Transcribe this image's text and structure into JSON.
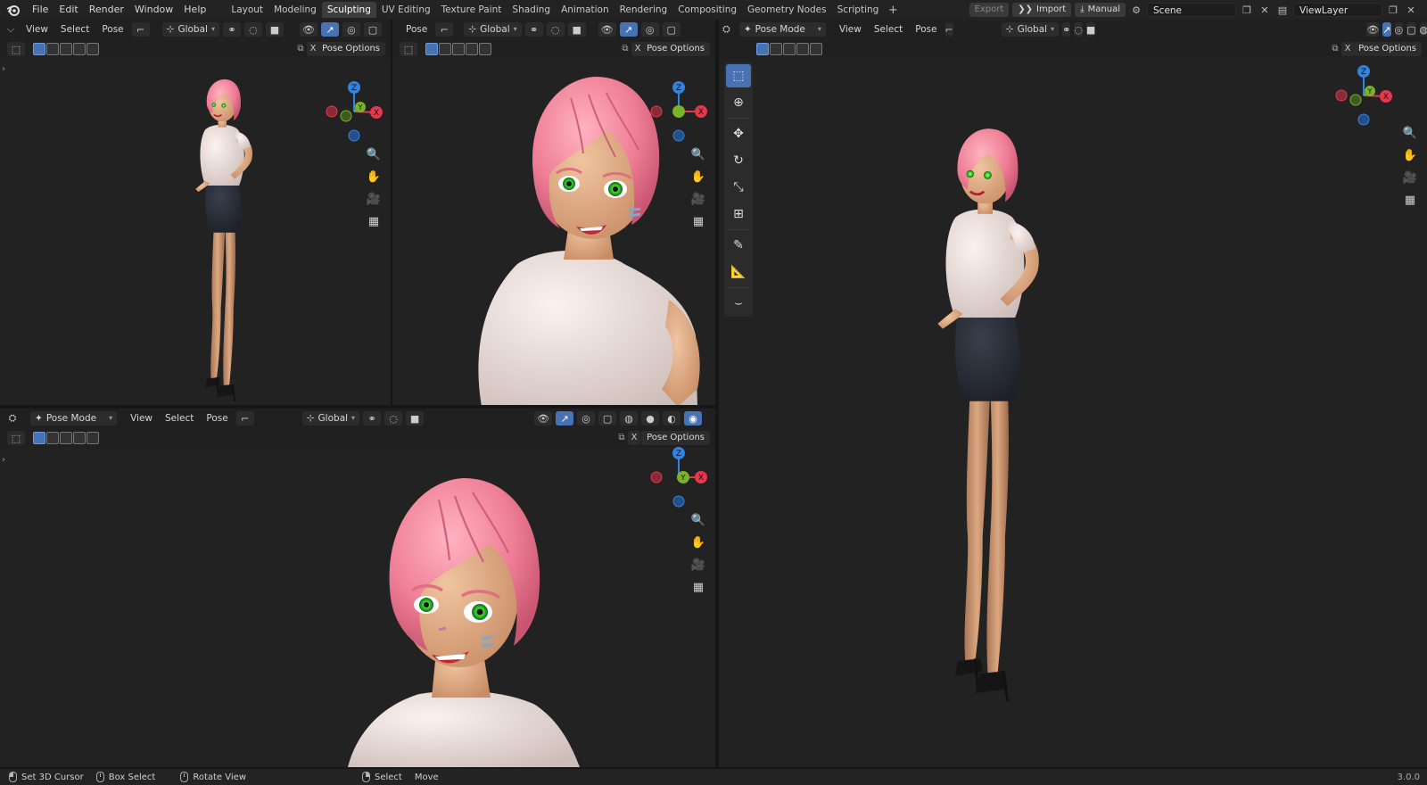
{
  "menus": [
    "File",
    "Edit",
    "Render",
    "Window",
    "Help"
  ],
  "workspaces": [
    "Layout",
    "Modeling",
    "Sculpting",
    "UV Editing",
    "Texture Paint",
    "Shading",
    "Animation",
    "Rendering",
    "Compositing",
    "Geometry Nodes",
    "Scripting"
  ],
  "active_workspace": "Sculpting",
  "topright": {
    "export": "Export",
    "import": "Import",
    "manual": "Manual",
    "scene": "Scene",
    "view_layer": "ViewLayer"
  },
  "vp_tl": {
    "view": "View",
    "select": "Select",
    "pose": "Pose",
    "orientation": "Global",
    "pose_options": "Pose Options",
    "x": "X"
  },
  "vp_tm": {
    "pose": "Pose",
    "orientation": "Global",
    "pose_options": "Pose Options",
    "x": "X"
  },
  "vp_bl": {
    "mode": "Pose Mode",
    "view": "View",
    "select": "Select",
    "pose": "Pose",
    "orientation": "Global",
    "pose_options": "Pose Options",
    "x": "X"
  },
  "vp_r": {
    "mode": "Pose Mode",
    "view": "View",
    "select": "Select",
    "pose": "Pose",
    "orientation": "Global",
    "pose_options": "Pose Options",
    "x": "X"
  },
  "gizmo": {
    "z": "Z",
    "y": "Y",
    "x": "X"
  },
  "tools": [
    "select-box",
    "cursor",
    "move",
    "rotate",
    "scale",
    "transform",
    "annotate",
    "measure",
    "pose-tool"
  ],
  "status": {
    "cursor": "Set 3D Cursor",
    "box": "Box Select",
    "rotate": "Rotate View",
    "select": "Select",
    "move": "Move",
    "version": "3.0.0"
  },
  "colors": {
    "accent": "#4772b3",
    "axis_x": "#e5384c",
    "axis_y": "#79b22b",
    "axis_z": "#2f83e2",
    "hair": "#f08aa0",
    "shirt": "#efe4e2",
    "skin": "#d9a47e",
    "shorts": "#2b2f38"
  }
}
